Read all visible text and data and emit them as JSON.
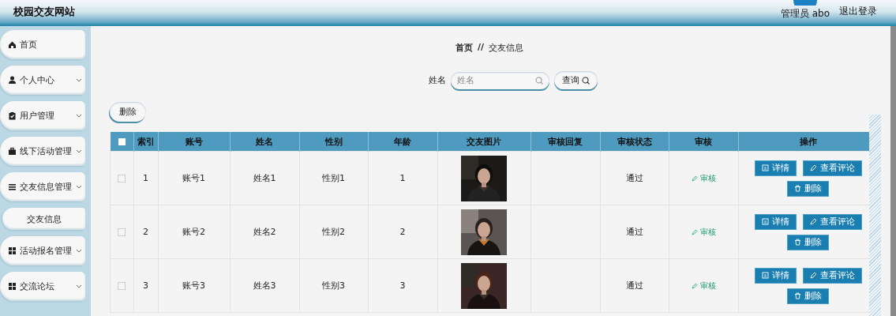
{
  "header": {
    "title": "校园交友网站",
    "user": "管理员 abo",
    "logout": "退出登录"
  },
  "sidebar": {
    "items": [
      {
        "kind": "menu",
        "label": "首页",
        "expandable": false
      },
      {
        "kind": "menu",
        "label": "个人中心",
        "expandable": true
      },
      {
        "kind": "menu",
        "label": "用户管理",
        "expandable": true
      },
      {
        "kind": "menu",
        "label": "线下活动管理",
        "expandable": true
      },
      {
        "kind": "menu",
        "label": "交友信息管理",
        "expandable": true
      },
      {
        "kind": "sub",
        "label": "交友信息"
      },
      {
        "kind": "menu",
        "label": "活动报名管理",
        "expandable": true
      },
      {
        "kind": "menu",
        "label": "交流论坛",
        "expandable": true
      }
    ]
  },
  "breadcrumb": {
    "home": "首页",
    "separator": "//",
    "current": "交友信息"
  },
  "search": {
    "label": "姓名",
    "placeholder": "姓名",
    "button": "查询"
  },
  "delete_button": "删除",
  "table": {
    "all_selected": false,
    "columns": [
      "索引",
      "账号",
      "姓名",
      "性别",
      "年龄",
      "交友图片",
      "审核回复",
      "审核状态",
      "审核",
      "操作"
    ],
    "rows": [
      {
        "selected": false,
        "index": "1",
        "account": "账号1",
        "name": "姓名1",
        "gender": "性别1",
        "age": "1",
        "status": "通过",
        "review": "审核",
        "actions": [
          "详情",
          "查看评论",
          "删除"
        ]
      },
      {
        "selected": false,
        "index": "2",
        "account": "账号2",
        "name": "姓名2",
        "gender": "性别2",
        "age": "2",
        "status": "通过",
        "review": "审核",
        "actions": [
          "详情",
          "查看评论",
          "删除"
        ]
      },
      {
        "selected": false,
        "index": "3",
        "account": "账号3",
        "name": "姓名3",
        "gender": "性别3",
        "age": "3",
        "status": "通过",
        "review": "审核",
        "actions": [
          "详情",
          "查看评论",
          "删除"
        ]
      }
    ]
  }
}
